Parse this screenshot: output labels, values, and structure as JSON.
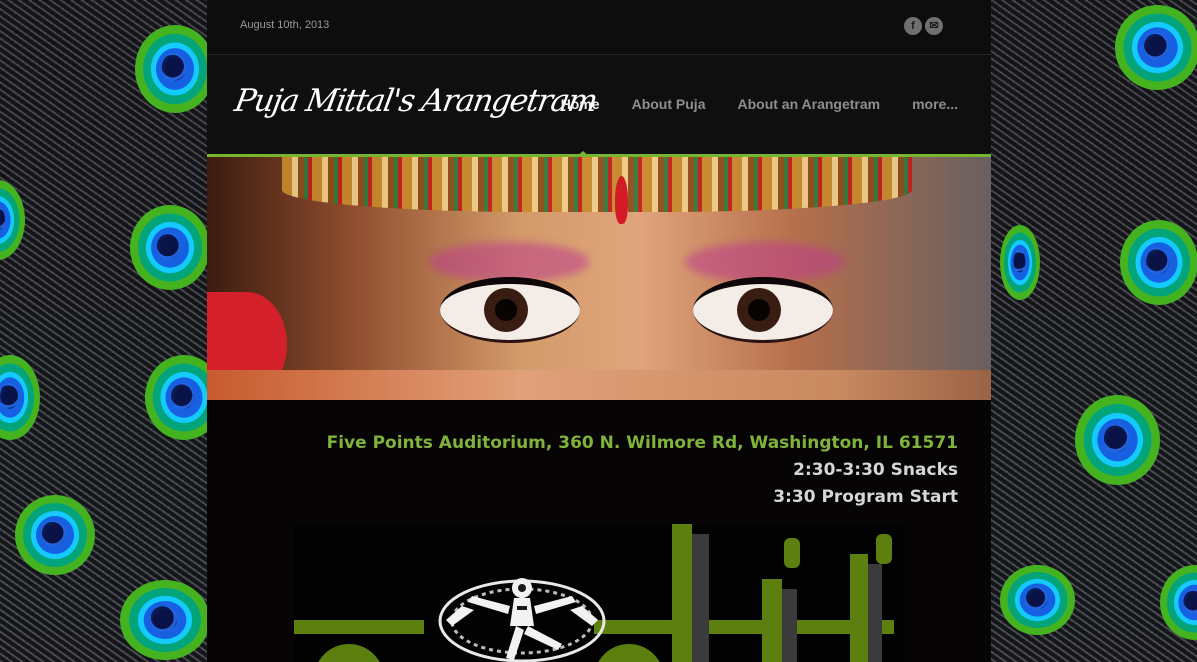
{
  "topbar": {
    "date": "August 10th, 2013",
    "social": [
      {
        "icon": "facebook-icon",
        "glyph": "f"
      },
      {
        "icon": "email-icon",
        "glyph": "✉"
      }
    ]
  },
  "header": {
    "site_title": "Puja Mittal's Arangetram",
    "nav": [
      {
        "label": "Home",
        "active": true
      },
      {
        "label": "About Puja",
        "active": false
      },
      {
        "label": "About an Arangetram",
        "active": false
      },
      {
        "label": "more...",
        "active": false
      }
    ]
  },
  "event": {
    "venue": "Five Points Auditorium, 360 N. Wilmore Rd, Washington, IL 61571",
    "snacks": "2:30-3:30 Snacks",
    "program": "3:30 Program Start"
  },
  "colors": {
    "accent": "#77b52f",
    "venue_text": "#7fb33b",
    "page_bg": "#060405"
  }
}
